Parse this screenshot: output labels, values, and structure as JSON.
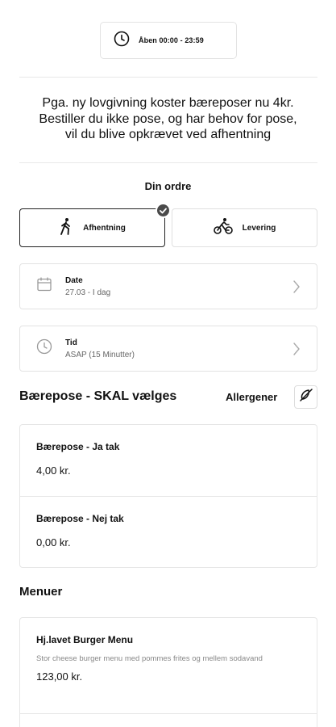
{
  "hours": {
    "label": "Åben 00:00 - 23:59",
    "icon": "clock-icon"
  },
  "notice": {
    "line1": "Pga. ny lovgivning koster bæreposer nu 4kr.",
    "line2": "Bestiller du ikke pose, og har behov for pose,",
    "line3": "vil du blive opkrævet ved afhentning"
  },
  "order": {
    "title": "Din ordre",
    "options": [
      {
        "label": "Afhentning",
        "icon": "walking-person-icon",
        "selected": true
      },
      {
        "label": "Levering",
        "icon": "bicycle-icon",
        "selected": false
      }
    ]
  },
  "date": {
    "label": "Date",
    "value": "27.03 - I dag",
    "icon": "calendar-icon"
  },
  "time": {
    "label": "Tid",
    "value": "ASAP (15 Minutter)",
    "icon": "clock-icon"
  },
  "bag_section": {
    "title": "Bærepose - SKAL vælges",
    "allergen_label": "Allergener",
    "items": [
      {
        "name": "Bærepose - Ja tak",
        "price": "4,00 kr."
      },
      {
        "name": "Bærepose - Nej tak",
        "price": "0,00 kr."
      }
    ]
  },
  "menus": {
    "title": "Menuer",
    "items": [
      {
        "name": "Hj.lavet Burger Menu",
        "description": "Stor cheese burger menu med pommes frites og mellem sodavand",
        "price": "123,00 kr."
      }
    ]
  },
  "colors": {
    "text": "#111111",
    "muted": "#888888",
    "border": "#e3e3e3",
    "check_badge": "#4a4a4a"
  }
}
